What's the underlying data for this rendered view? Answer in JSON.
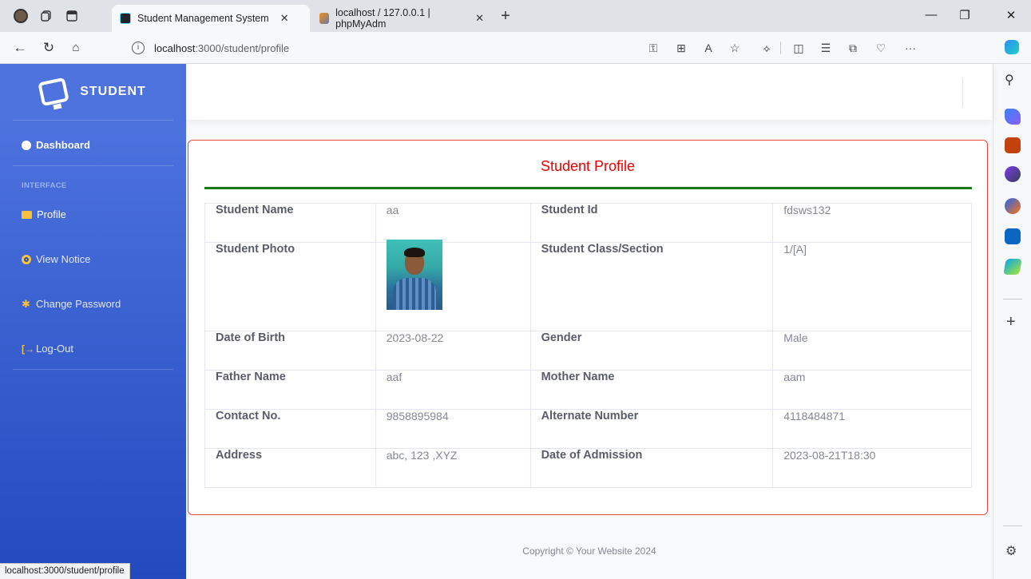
{
  "browser": {
    "tabs": [
      {
        "title": "Student Management System",
        "active": true
      },
      {
        "title": "localhost / 127.0.0.1 | phpMyAdm",
        "active": false
      }
    ],
    "url_host": "localhost",
    "url_path": ":3000/student/profile",
    "status_url": "localhost:3000/student/profile"
  },
  "sidebar": {
    "brand": "STUDENT",
    "dashboard": "Dashboard",
    "heading": "INTERFACE",
    "items": [
      {
        "label": "Profile",
        "icon": "folder-icon"
      },
      {
        "label": "View Notice",
        "icon": "eye-icon"
      },
      {
        "label": "Change Password",
        "icon": "cog-icon"
      },
      {
        "label": "Log-Out",
        "icon": "sign-out-icon"
      }
    ]
  },
  "profile": {
    "title": "Student Profile",
    "rows": [
      {
        "l1": "Student Name",
        "v1": "aa",
        "l2": "Student Id",
        "v2": "fdsws132"
      },
      {
        "l1": "Student Photo",
        "v1": "",
        "l2": "Student Class/Section",
        "v2": "1/[A]"
      },
      {
        "l1": "Date of Birth",
        "v1": "2023-08-22",
        "l2": "Gender",
        "v2": "Male"
      },
      {
        "l1": "Father Name",
        "v1": "aaf",
        "l2": "Mother Name",
        "v2": "aam"
      },
      {
        "l1": "Contact No.",
        "v1": "9858895984",
        "l2": "Alternate Number",
        "v2": "4118484871"
      },
      {
        "l1": "Address",
        "v1": "abc, 123 ,XYZ",
        "l2": "Date of Admission",
        "v2": "2023-08-21T18:30"
      }
    ]
  },
  "footer": "Copyright © Your Website 2024",
  "colors": {
    "sidebar_start": "#4e73df",
    "sidebar_end": "#224abe",
    "card_border": "#e74a3b",
    "title": "#ee0000",
    "rule": "#1a7a1a"
  }
}
